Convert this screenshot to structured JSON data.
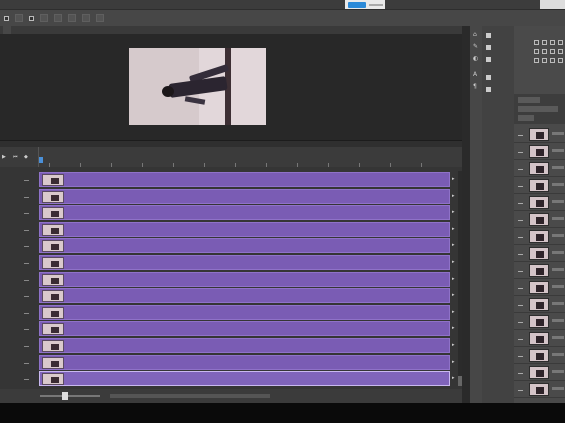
{
  "menubar": {
    "items": [
      "",
      "",
      "",
      "",
      "",
      "",
      "",
      "",
      "",
      "",
      ""
    ]
  },
  "optionsbar": {
    "items": [
      "",
      "",
      "",
      "",
      "",
      ""
    ]
  },
  "document_tab": "",
  "timeline": {
    "ruler_ticks": [
      "",
      "",
      "",
      "",
      "",
      "",
      "",
      "",
      "",
      "",
      "",
      "",
      ""
    ],
    "tracks": [
      {
        "label": "",
        "selected": false
      },
      {
        "label": "",
        "selected": false
      },
      {
        "label": "",
        "selected": false
      },
      {
        "label": "",
        "selected": false
      },
      {
        "label": "",
        "selected": false
      },
      {
        "label": "",
        "selected": false
      },
      {
        "label": "",
        "selected": false
      },
      {
        "label": "",
        "selected": false
      },
      {
        "label": "",
        "selected": false
      },
      {
        "label": "",
        "selected": false
      },
      {
        "label": "",
        "selected": false
      },
      {
        "label": "",
        "selected": false
      },
      {
        "label": "",
        "selected": true
      }
    ]
  },
  "properties_panel": {
    "items": [
      "",
      "",
      "",
      "",
      ""
    ]
  },
  "layers_panel": {
    "tab": "",
    "row_count": 16
  },
  "colors": {
    "clip_purple": "#7a5cb4",
    "panel_gray": "#474747",
    "canvas_bg": "#282828"
  }
}
